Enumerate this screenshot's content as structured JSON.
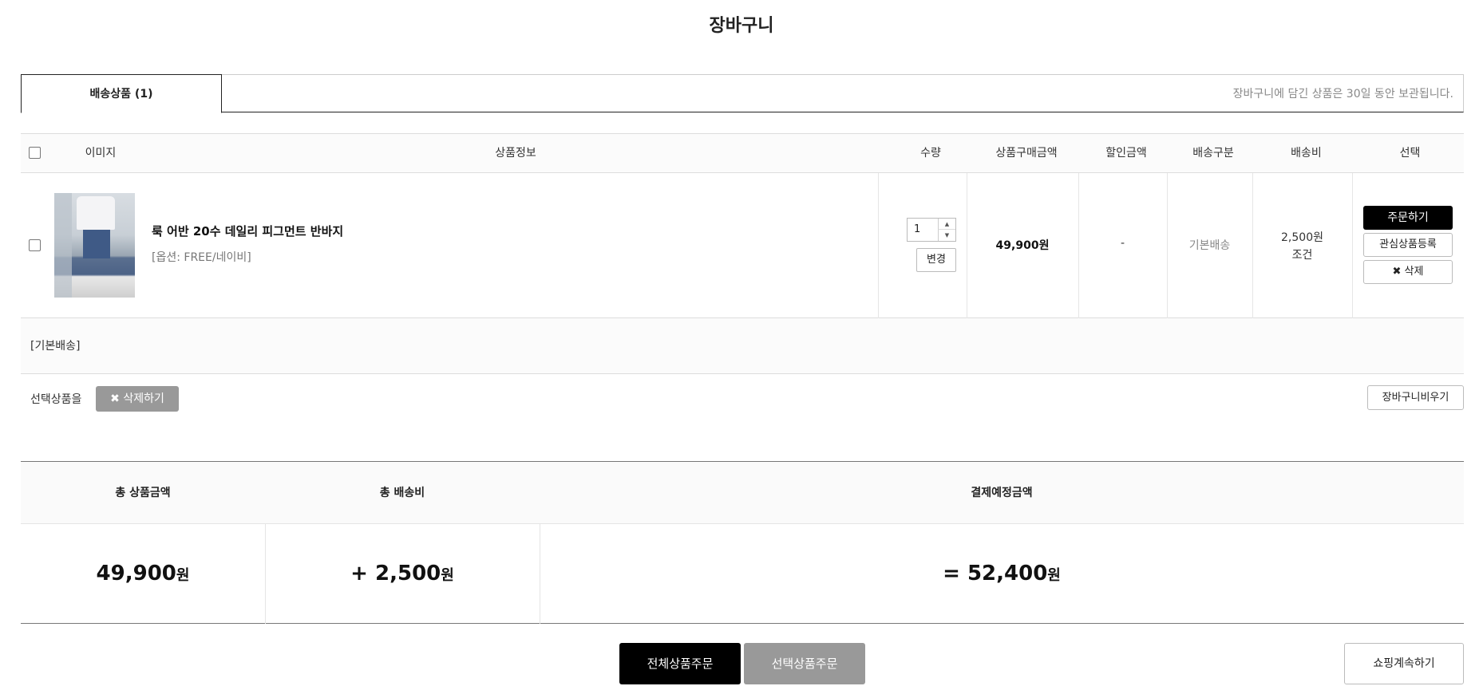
{
  "page": {
    "title": "장바구니"
  },
  "tabs": {
    "active_label": "배송상품 (1)",
    "notice": "장바구니에 담긴 상품은 30일 동안 보관됩니다."
  },
  "table": {
    "headers": {
      "image": "이미지",
      "info": "상품정보",
      "qty": "수량",
      "price": "상품구매금액",
      "discount": "할인금액",
      "ship_type": "배송구분",
      "ship_fee": "배송비",
      "select": "선택"
    },
    "item": {
      "name": "룩 어반 20수 데일리 피그먼트 반바지",
      "option": "[옵션: FREE/네이비]",
      "quantity": "1",
      "change_label": "변경",
      "price": "49,900원",
      "discount": "-",
      "ship_type": "기본배송",
      "ship_fee": "2,500원",
      "ship_condition": "조건",
      "order_label": "주문하기",
      "wish_label": "관심상품등록",
      "delete_label": "✖ 삭제"
    },
    "group_label": "[기본배송]"
  },
  "actions": {
    "selected_label": "선택상품을",
    "delete_selected": "✖ 삭제하기",
    "empty_cart": "장바구니비우기"
  },
  "summary": {
    "total_label": "총 상품금액",
    "ship_label": "총 배송비",
    "pay_label": "결제예정금액",
    "total_value": "49,900",
    "ship_value": "+ 2,500",
    "pay_value": "= 52,400",
    "unit": "원"
  },
  "bottom": {
    "order_all": "전체상품주문",
    "order_selected": "선택상품주문",
    "continue": "쇼핑계속하기"
  }
}
